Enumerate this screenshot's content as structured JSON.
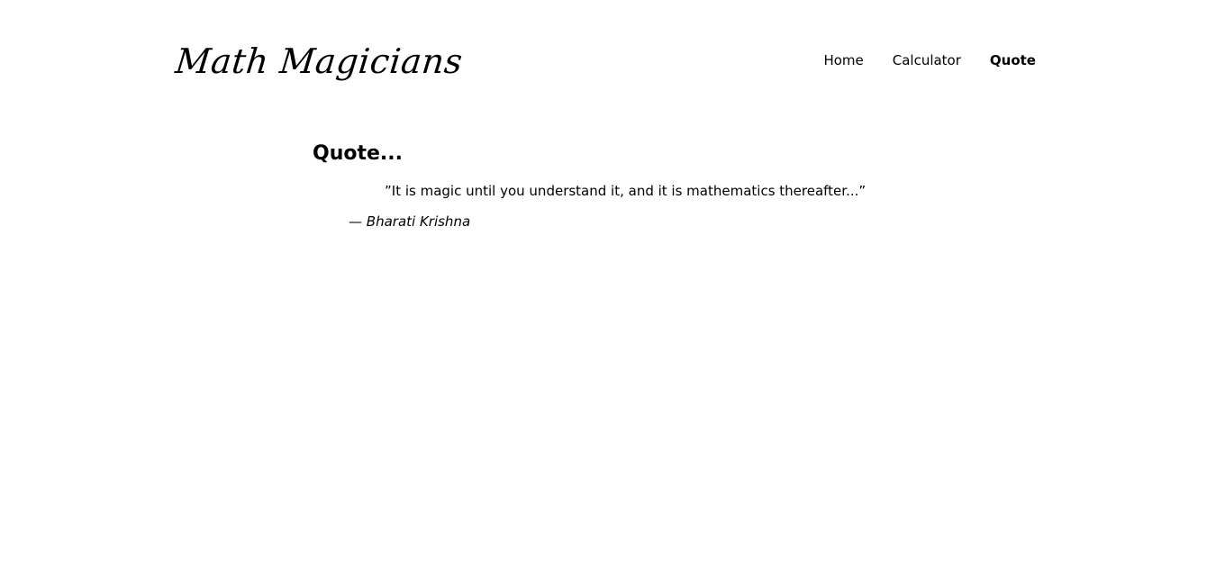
{
  "header": {
    "logo": "Math Magicians",
    "nav": [
      {
        "label": "Home",
        "active": false
      },
      {
        "label": "Calculator",
        "active": false
      },
      {
        "label": "Quote",
        "active": true
      }
    ]
  },
  "main": {
    "title": "Quote...",
    "quote": "”It is magic until you understand it, and it is mathematics thereafter...”",
    "author_dash": "—",
    "author": "Bharati Krishna"
  }
}
